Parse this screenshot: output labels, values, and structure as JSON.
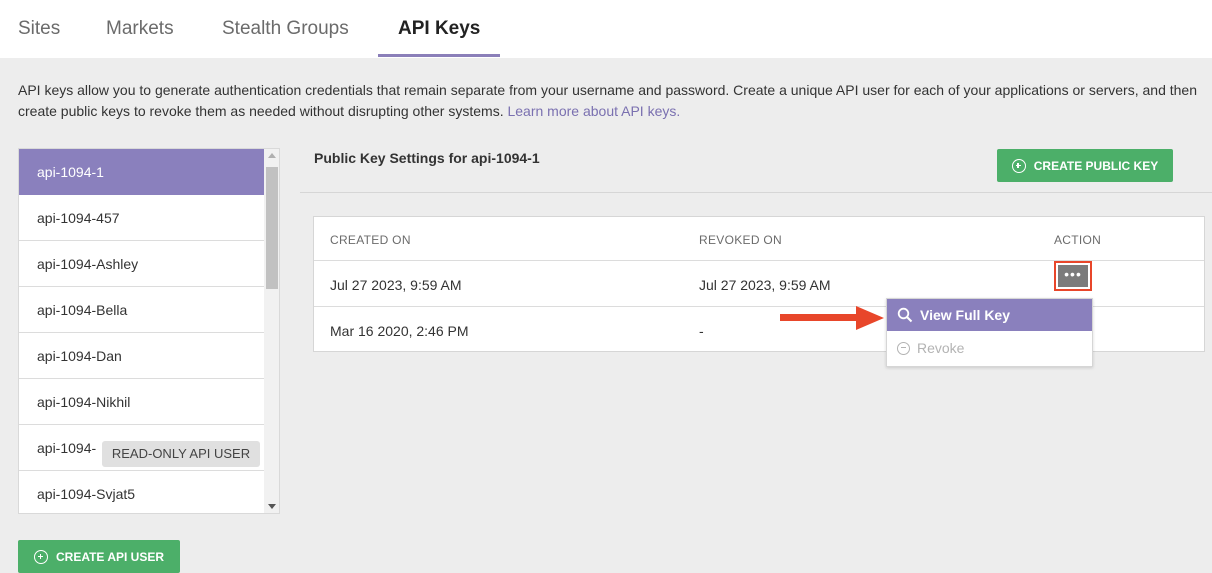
{
  "tabs": [
    {
      "label": "Sites"
    },
    {
      "label": "Markets"
    },
    {
      "label": "Stealth Groups"
    },
    {
      "label": "API Keys",
      "active": true
    }
  ],
  "description": {
    "text": "API keys allow you to generate authentication credentials that remain separate from your username and password. Create a unique API user for each of your applications or servers, and then create public keys to revoke them as needed without disrupting other systems.",
    "link": "Learn more about API keys."
  },
  "api_users": [
    {
      "label": "api-1094-1",
      "selected": true
    },
    {
      "label": "api-1094-457"
    },
    {
      "label": "api-1094-Ashley"
    },
    {
      "label": "api-1094-Bella"
    },
    {
      "label": "api-1094-Dan"
    },
    {
      "label": "api-1094-Nikhil"
    },
    {
      "label": "api-1094-"
    },
    {
      "label": "api-1094-Svjat5"
    }
  ],
  "tooltip": "READ-ONLY API USER",
  "create_api_user": "CREATE API USER",
  "public_keys": {
    "title": "Public Key Settings for api-1094-1",
    "create_button": "CREATE PUBLIC KEY",
    "columns": [
      "CREATED ON",
      "REVOKED ON",
      "ACTION"
    ],
    "rows": [
      {
        "created": "Jul 27 2023, 9:59 AM",
        "revoked": "Jul 27 2023, 9:59 AM"
      },
      {
        "created": "Mar 16 2020, 2:46 PM",
        "revoked": "-"
      }
    ],
    "action_button": "•••"
  },
  "action_menu": {
    "items": [
      {
        "label": "View Full Key",
        "icon": "search-icon"
      },
      {
        "label": "Revoke",
        "icon": "minus-circle-icon",
        "disabled": true
      }
    ]
  },
  "colors": {
    "accent": "#8a80bd",
    "green": "#4caf69",
    "highlight": "#e8462a"
  }
}
